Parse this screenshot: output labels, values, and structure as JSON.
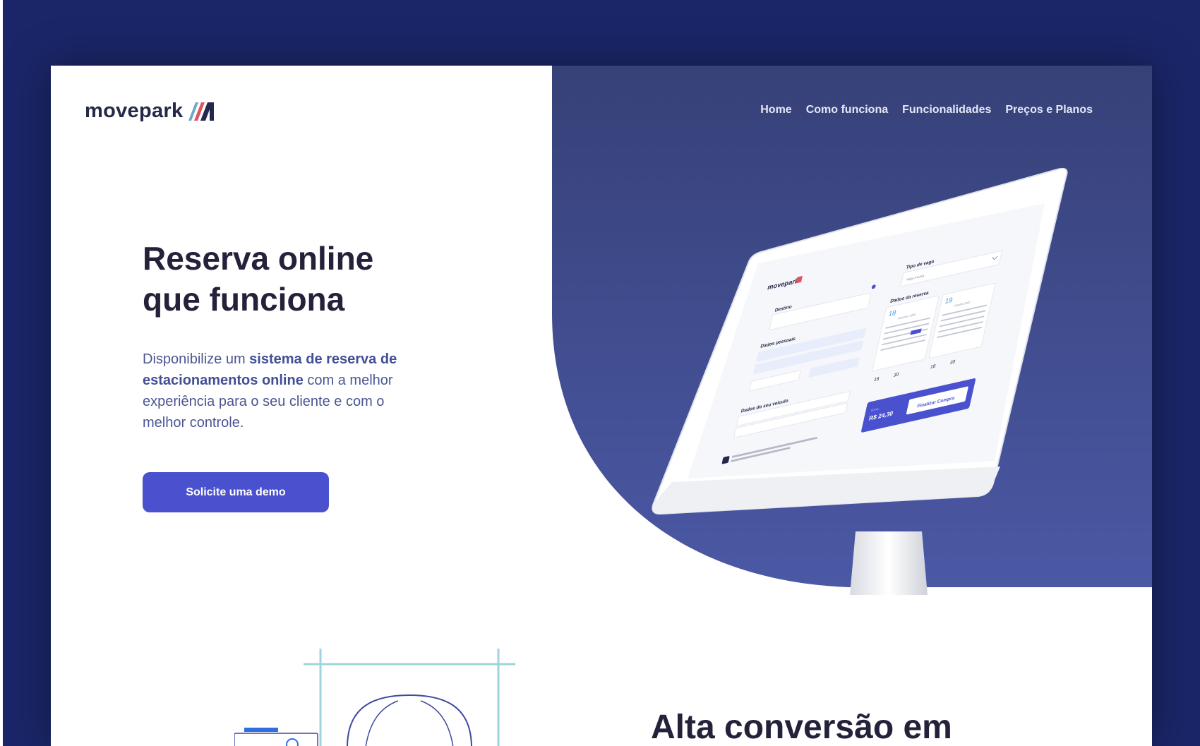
{
  "brand": {
    "name": "movepark"
  },
  "nav": {
    "items": [
      {
        "label": "Home"
      },
      {
        "label": "Como funciona"
      },
      {
        "label": "Funcionalidades"
      },
      {
        "label": "Preços e Planos"
      }
    ]
  },
  "hero": {
    "headline_line1": "Reserva online",
    "headline_line2": "que funciona",
    "lead_part1": "Disponibilize um ",
    "lead_bold": "sistema de reserva de estacionamentos online",
    "lead_part2": " com a melhor experiência para o seu cliente e com o melhor controle.",
    "cta_label": "Solicite uma demo"
  },
  "mockup": {
    "brand": "movepark",
    "destino_label": "Destino",
    "dados_pessoais_label": "Dados pessoais",
    "dados_veiculo_label": "Dados do seu veículo",
    "tipo_vaga_label": "Tipo de vaga",
    "tipo_vaga_value": "Vaga Avulsa",
    "dados_reserva_label": "Dados da reserva",
    "date_start_day": "18",
    "date_start_month": "Setembro 2020",
    "date_end_day": "19",
    "date_end_month": "Outubro 2020",
    "time_start_hour": "18",
    "time_start_min": "30",
    "time_end_hour": "18",
    "time_end_min": "30",
    "total_label": "TOTAL:",
    "total_value": "R$ 24,30",
    "finalize_label": "Finalizar Compra"
  },
  "second": {
    "headline": "Alta conversão em"
  },
  "colors": {
    "background": "#1a2668",
    "hero_panel": "#3a4784",
    "accent": "#4a51cf",
    "heading": "#23223a"
  }
}
